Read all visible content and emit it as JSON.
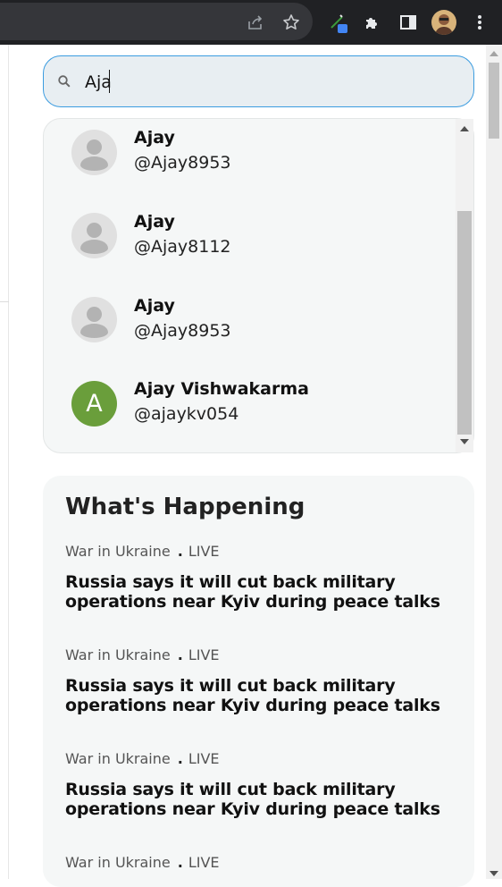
{
  "search": {
    "value": "Aja",
    "placeholder": "Search"
  },
  "results": [
    {
      "name": "Ajay",
      "handle": "@Ajay8953",
      "avatar": "default-avatar-icon"
    },
    {
      "name": "Ajay",
      "handle": "@Ajay8112",
      "avatar": "default-avatar-icon"
    },
    {
      "name": "Ajay",
      "handle": "@Ajay8953",
      "avatar": "default-avatar-icon"
    },
    {
      "name": "Ajay Vishwakarma",
      "handle": "@ajaykv054",
      "avatar_letter": "A",
      "avatar_color": "#6a9e3b"
    }
  ],
  "happening": {
    "title": "What's Happening",
    "items": [
      {
        "topic": "War in Ukraine",
        "dot": ".",
        "status": "LIVE",
        "headline": "Russia says it will cut back military operations near Kyiv during peace talks"
      },
      {
        "topic": "War in Ukraine",
        "dot": ".",
        "status": "LIVE",
        "headline": "Russia says it will cut back military operations near Kyiv during peace talks"
      },
      {
        "topic": "War in Ukraine",
        "dot": ".",
        "status": "LIVE",
        "headline": "Russia says it will cut back military operations near Kyiv during peace talks"
      },
      {
        "topic": "War in Ukraine",
        "dot": ".",
        "status": "LIVE",
        "headline": ""
      }
    ]
  },
  "toolbar": {
    "icons": [
      "share-icon",
      "star-icon",
      "pen-extension-icon",
      "puzzle-extensions-icon",
      "side-panel-icon",
      "profile-avatar",
      "kebab-menu-icon"
    ]
  },
  "colors": {
    "search_border": "#3b9ce0",
    "search_bg": "#e8eef2",
    "panel_bg": "#f5f7f7",
    "toolbar_bg": "#202124"
  }
}
